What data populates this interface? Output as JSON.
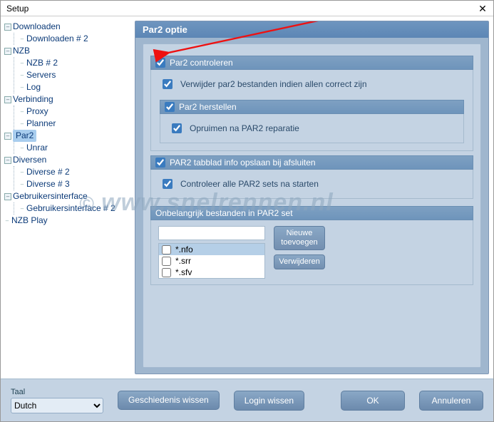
{
  "window": {
    "title": "Setup"
  },
  "tree": {
    "items": [
      {
        "label": "Downloaden",
        "children": [
          {
            "label": "Downloaden # 2"
          }
        ]
      },
      {
        "label": "NZB",
        "children": [
          {
            "label": "NZB # 2"
          },
          {
            "label": "Servers"
          },
          {
            "label": "Log"
          }
        ]
      },
      {
        "label": "Verbinding",
        "children": [
          {
            "label": "Proxy"
          },
          {
            "label": "Planner"
          }
        ]
      },
      {
        "label": "Par2",
        "selected": true,
        "children": [
          {
            "label": "Unrar"
          }
        ]
      },
      {
        "label": "Diversen",
        "children": [
          {
            "label": "Diverse # 2"
          },
          {
            "label": "Diverse # 3"
          }
        ]
      },
      {
        "label": "Gebruikersinterface",
        "children": [
          {
            "label": "Gebruikersinterface # 2"
          }
        ]
      },
      {
        "label": "NZB Play",
        "children": []
      }
    ]
  },
  "panel": {
    "title": "Par2 optie",
    "group_control": {
      "title": "Par2 controleren",
      "sub": "Verwijder par2 bestanden indien allen correct zijn"
    },
    "group_repair": {
      "title": "Par2 herstellen",
      "sub": "Opruimen na PAR2 reparatie"
    },
    "group_tab": {
      "title": "PAR2 tabblad info opslaan bij afsluiten",
      "sub": "Controleer alle PAR2 sets na starten"
    },
    "group_unimportant": {
      "title": "Onbelangrijk bestanden in PAR2 set",
      "buttons": {
        "add": "Nieuwe toevoegen",
        "remove": "Verwijderen"
      },
      "input_value": "",
      "list": [
        {
          "label": "*.nfo",
          "checked": false,
          "selected": true
        },
        {
          "label": "*.srr",
          "checked": false
        },
        {
          "label": "*.sfv",
          "checked": false
        }
      ]
    }
  },
  "footer": {
    "lang_label": "Taal",
    "lang_value": "Dutch",
    "buttons": {
      "history": "Geschiedenis wissen",
      "login": "Login wissen",
      "ok": "OK",
      "cancel": "Annuleren"
    }
  },
  "watermark": "www.snelrennen.nl",
  "chart_data": null
}
